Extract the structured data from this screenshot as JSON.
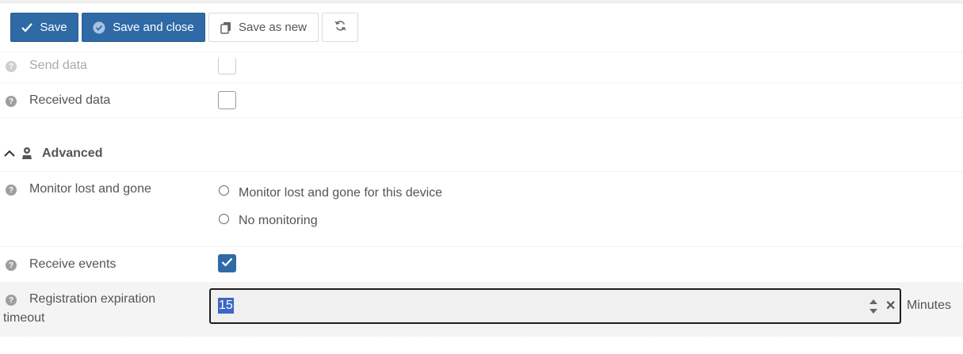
{
  "toolbar": {
    "save_label": "Save",
    "save_close_label": "Save and close",
    "save_new_label": "Save as new"
  },
  "rows": {
    "send_data_label": "Send data",
    "received_data_label": "Received data",
    "advanced_title": "Advanced",
    "monitor_label": "Monitor lost and gone",
    "monitor_options": [
      "Monitor lost and gone for this device",
      "No monitoring"
    ],
    "receive_events_label": "Receive events",
    "registration_label_1": "Registration expiration",
    "registration_label_2": "timeout",
    "registration_value": "15",
    "registration_unit": "Minutes",
    "help_glyph": "?"
  },
  "colors": {
    "primary": "#2f6aa6",
    "selection": "#3a67c5"
  },
  "icons": [
    "check-icon",
    "check-circle-icon",
    "copy-icon",
    "refresh-icon",
    "help-icon",
    "chevron-up-icon",
    "user-icon",
    "spinner-arrows-icon",
    "clear-icon"
  ]
}
